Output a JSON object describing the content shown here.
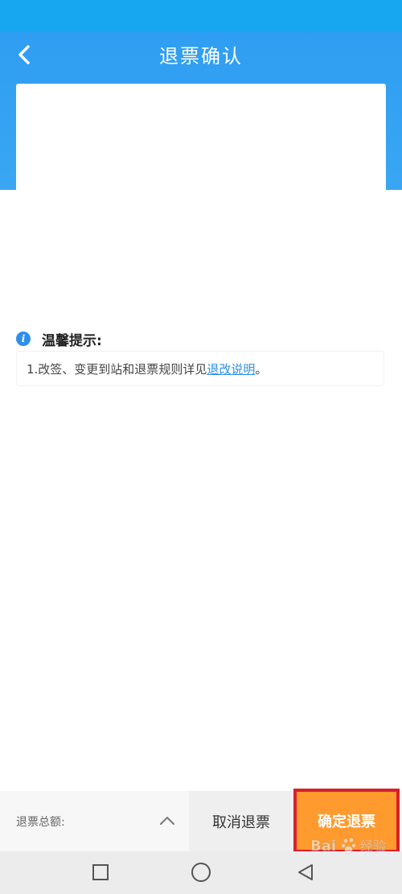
{
  "header": {
    "title": "退票确认",
    "back_icon": "chevron-left-icon"
  },
  "tips": {
    "icon": "info-icon",
    "title": "温馨提示:",
    "text_prefix": "1.改签、变更到站和退票规则详见",
    "link_text": "退改说明",
    "text_suffix": "。"
  },
  "bottom": {
    "total_label": "退票总额:",
    "expand_icon": "chevron-up-icon",
    "cancel_label": "取消退票",
    "confirm_label": "确定退票"
  },
  "nav": {
    "recent_icon": "square-icon",
    "home_icon": "circle-icon",
    "back_icon": "triangle-back-icon"
  },
  "colors": {
    "header_blue": "#2f9ef2",
    "status_bar_blue": "#17a7f0",
    "confirm_orange": "#ff9a2e",
    "highlight_red": "#d8202a",
    "link_blue": "#2f8fe8"
  }
}
